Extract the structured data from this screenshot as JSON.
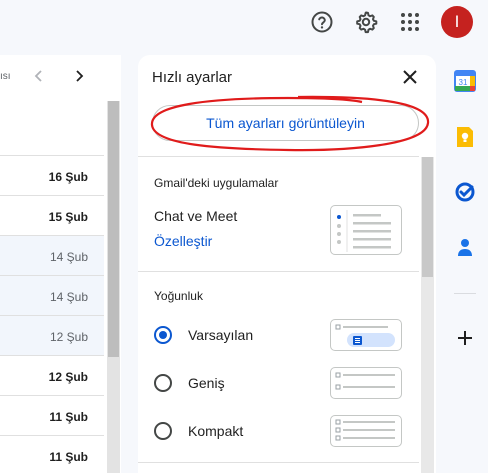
{
  "topbar": {
    "help_icon": "question-mark-circle",
    "settings_icon": "gear",
    "apps_icon": "grid-9-dots",
    "avatar_letter": "I",
    "avatar_color": "#c5221f"
  },
  "mail_list": {
    "pager_text": "ısı",
    "rows": [
      {
        "date": "16 Şub",
        "unread": true
      },
      {
        "date": "15 Şub",
        "unread": true
      },
      {
        "date": "14 Şub",
        "unread": false
      },
      {
        "date": "14 Şub",
        "unread": false
      },
      {
        "date": "12 Şub",
        "unread": false
      },
      {
        "date": "12 Şub",
        "unread": true
      },
      {
        "date": "11 Şub",
        "unread": true
      },
      {
        "date": "11 Şub",
        "unread": true
      }
    ]
  },
  "quick_settings": {
    "title": "Hızlı ayarlar",
    "all_settings_button": "Tüm ayarları görüntüleyin",
    "apps_section_label": "Gmail'deki uygulamalar",
    "chat_meet_label": "Chat ve Meet",
    "customize_link": "Özelleştir",
    "density_section_label": "Yoğunluk",
    "density_options": [
      {
        "label": "Varsayılan",
        "selected": true
      },
      {
        "label": "Geniş",
        "selected": false
      },
      {
        "label": "Kompakt",
        "selected": false
      }
    ],
    "annotation_color": "#e01b1b"
  },
  "right_rail": {
    "icons": [
      "calendar-icon",
      "keep-icon",
      "tasks-icon",
      "contacts-icon",
      "add-icon"
    ],
    "calendar_day": "31"
  },
  "colors": {
    "accent": "#0b57d0",
    "background": "#f6f8fc"
  }
}
